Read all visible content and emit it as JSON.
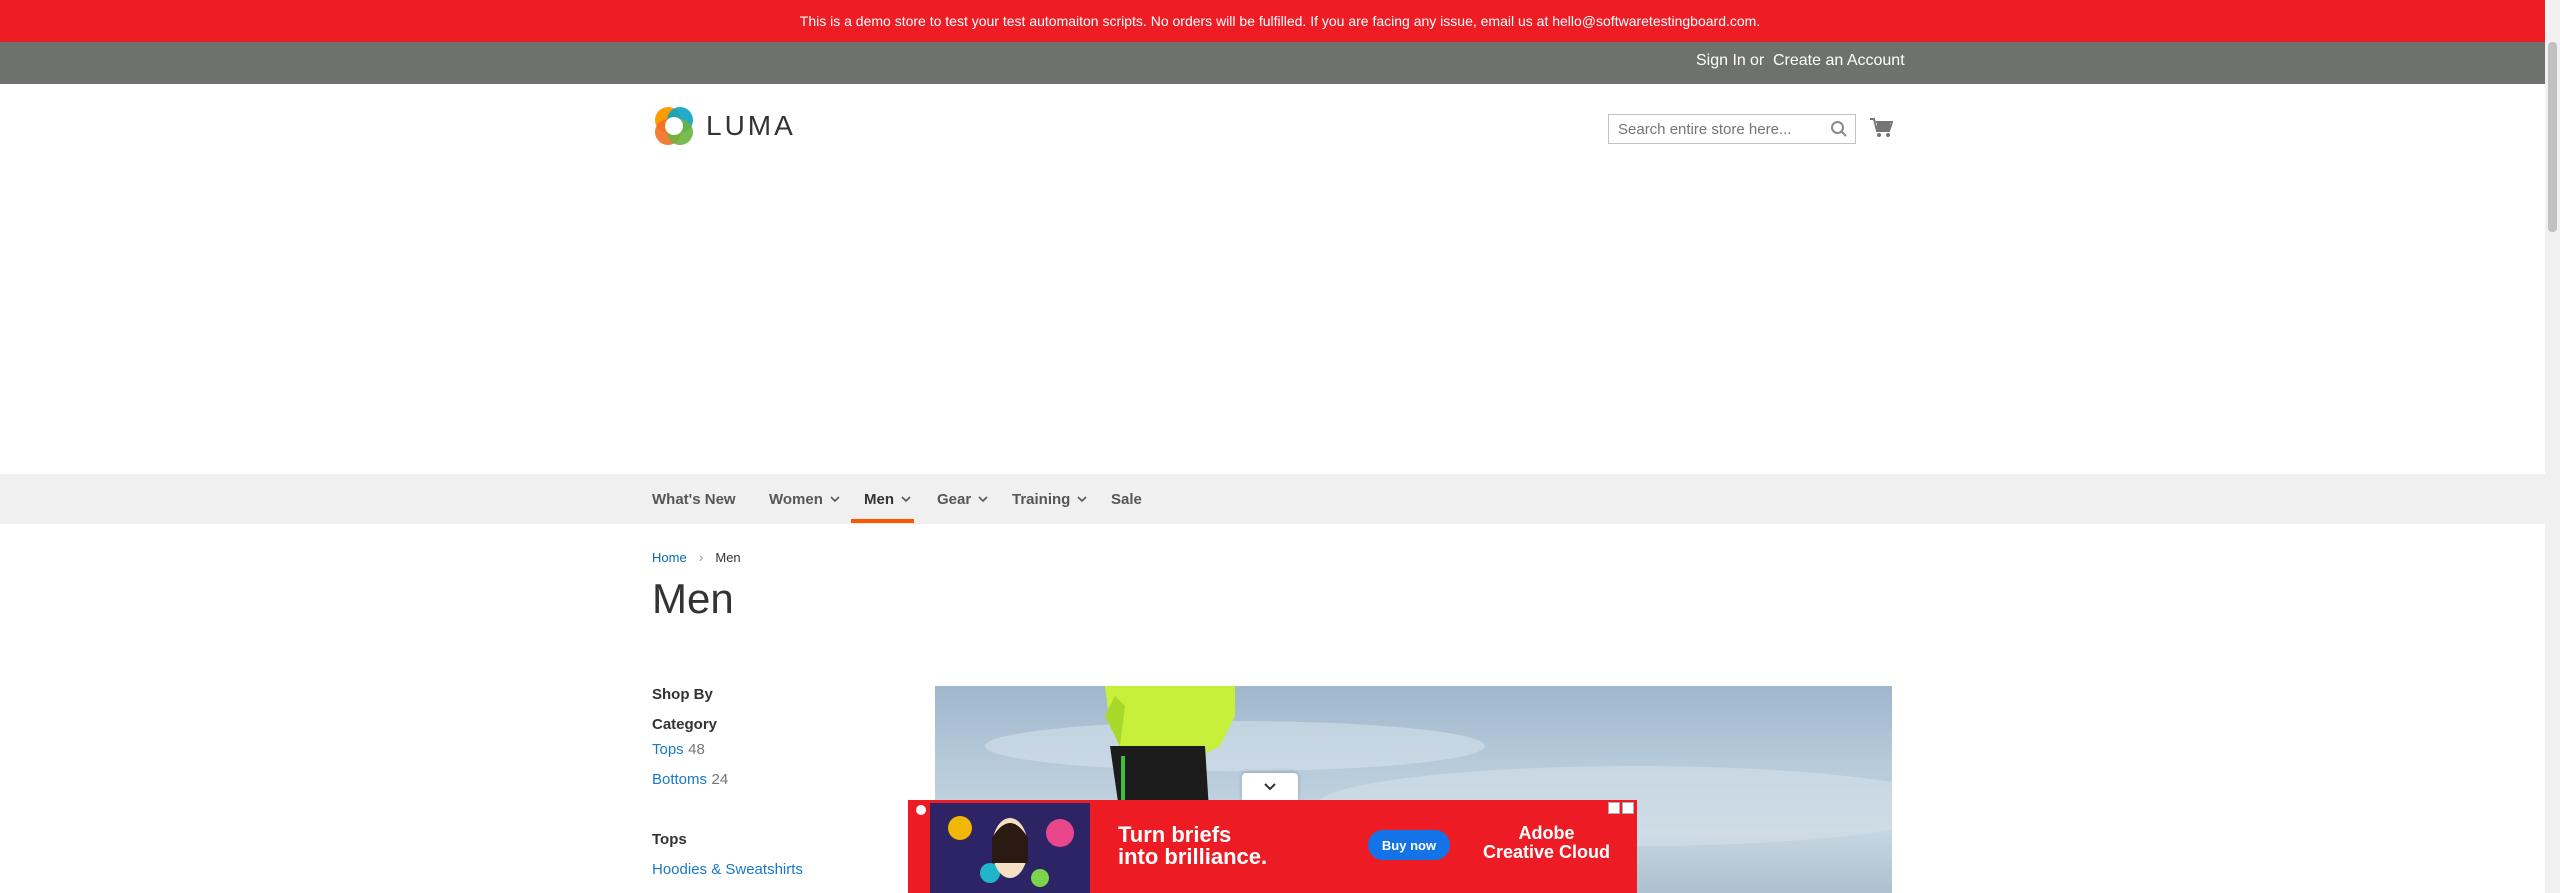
{
  "demo_banner": "This is a demo store to test your test automaiton scripts. No orders will be fulfilled. If you are facing any issue, email us at hello@softwaretestingboard.com.",
  "header": {
    "sign_in": "Sign In",
    "or": "or",
    "create_account": "Create an Account"
  },
  "logo": {
    "text": "LUMA"
  },
  "search": {
    "placeholder": "Search entire store here..."
  },
  "nav": {
    "items": [
      {
        "label": "What's New",
        "dropdown": false
      },
      {
        "label": "Women",
        "dropdown": true
      },
      {
        "label": "Men",
        "dropdown": true,
        "active": true
      },
      {
        "label": "Gear",
        "dropdown": true
      },
      {
        "label": "Training",
        "dropdown": true
      },
      {
        "label": "Sale",
        "dropdown": false
      }
    ]
  },
  "breadcrumb": {
    "home": "Home",
    "current": "Men"
  },
  "page_title": "Men",
  "sidebar": {
    "shop_by": "Shop By",
    "category_title": "Category",
    "categories": [
      {
        "label": "Tops",
        "count": "48"
      },
      {
        "label": "Bottoms",
        "count": "24"
      }
    ],
    "tops_title": "Tops",
    "tops_links": [
      {
        "label": "Hoodies & Sweatshirts"
      }
    ]
  },
  "ad": {
    "headline_line1": "Turn briefs",
    "headline_line2": "into brilliance.",
    "button": "Buy now",
    "brand_line1": "Adobe",
    "brand_line2": "Creative Cloud"
  },
  "colors": {
    "banner": "#ee1c25",
    "header": "#6e716e",
    "link": "#1979c3",
    "nav_active": "#ff5501",
    "ad_bg": "#ed1c24",
    "ad_button": "#1473e6"
  }
}
